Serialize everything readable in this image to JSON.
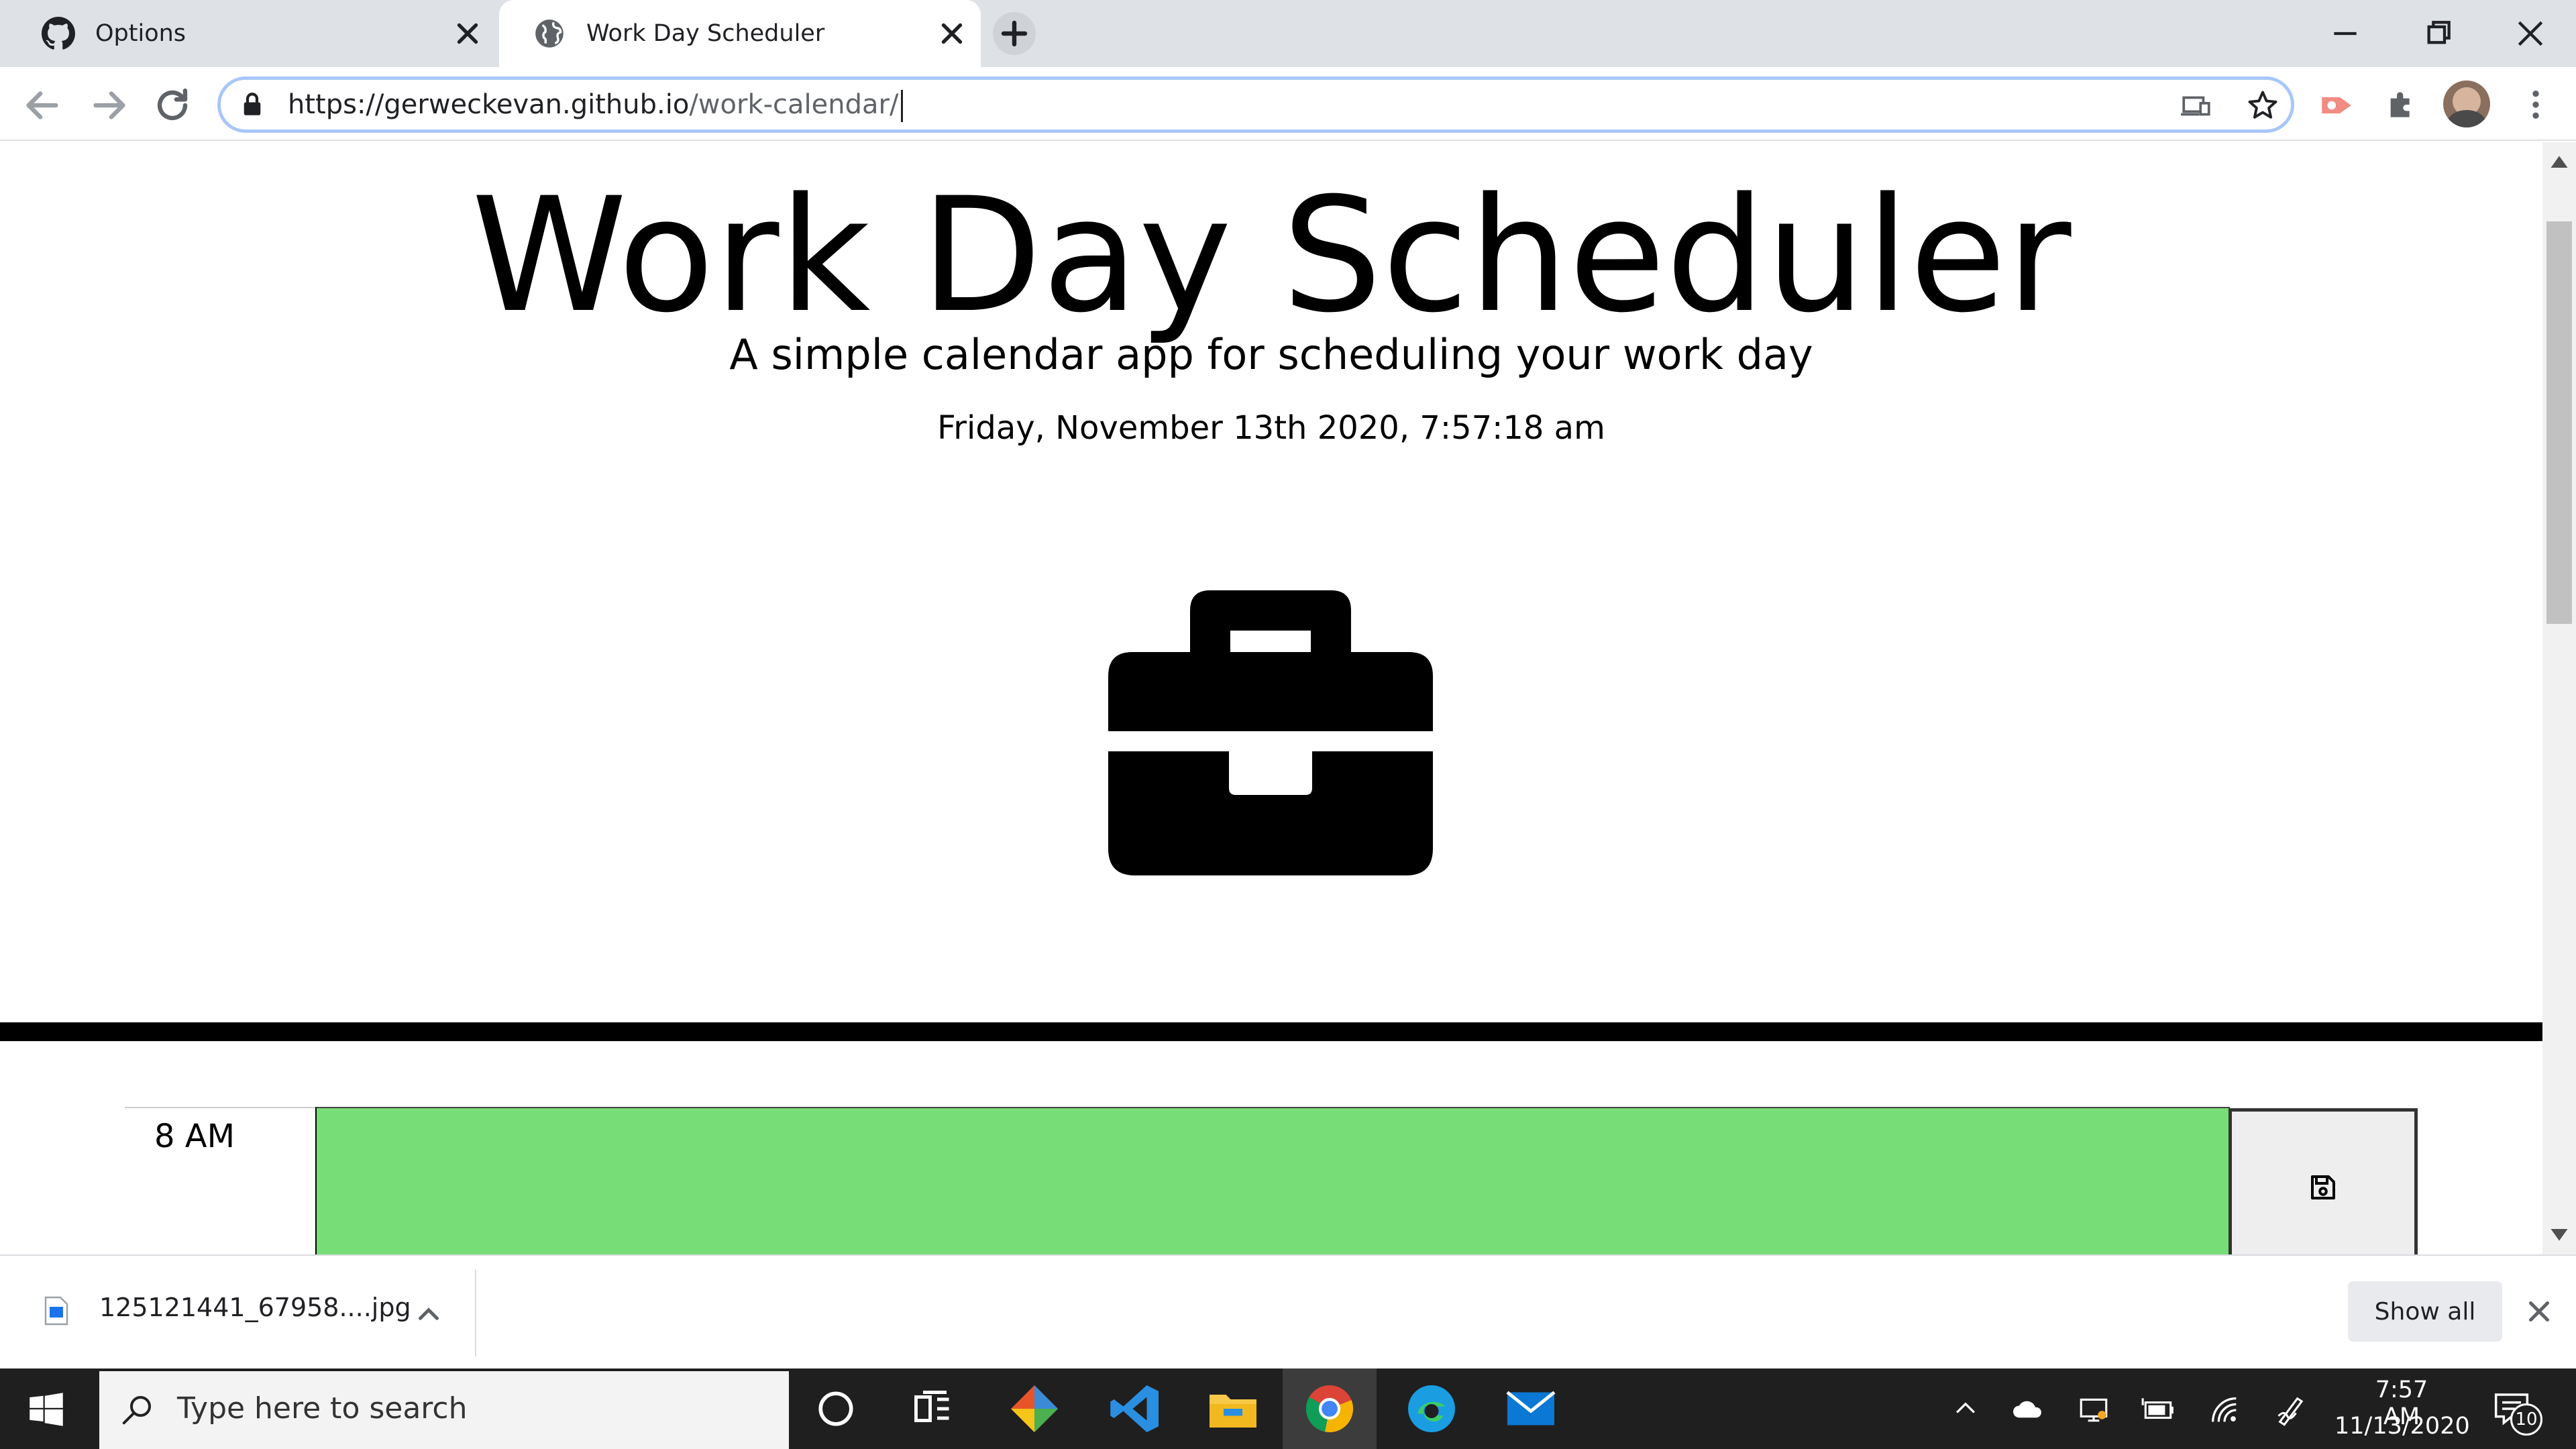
{
  "browser": {
    "tabs": [
      {
        "title": "Options",
        "icon": "github-icon"
      },
      {
        "title": "Work Day Scheduler",
        "icon": "globe-icon",
        "active": true
      }
    ],
    "address": {
      "url_host": "https://gerweckevan.github.io",
      "url_path": "/work-calendar/"
    }
  },
  "page": {
    "title": "Work Day Scheduler",
    "lead": "A simple calendar app for scheduling your work day",
    "current_day": "Friday, November 13th 2020, 7:57:18 am",
    "hero_icon": "briefcase-icon",
    "rows": [
      {
        "hour": "8 AM",
        "status": "future",
        "color": "#77dd77",
        "text": ""
      }
    ]
  },
  "downloads": {
    "file_name": "125121441_67958....jpg",
    "show_all_label": "Show all"
  },
  "taskbar": {
    "search_placeholder": "Type here to search",
    "time": "7:57 AM",
    "date": "11/13/2020",
    "notification_count": "10"
  },
  "colors": {
    "future": "#77dd77",
    "accent": "#1a73e8",
    "tabstrip": "#dee1e6"
  }
}
